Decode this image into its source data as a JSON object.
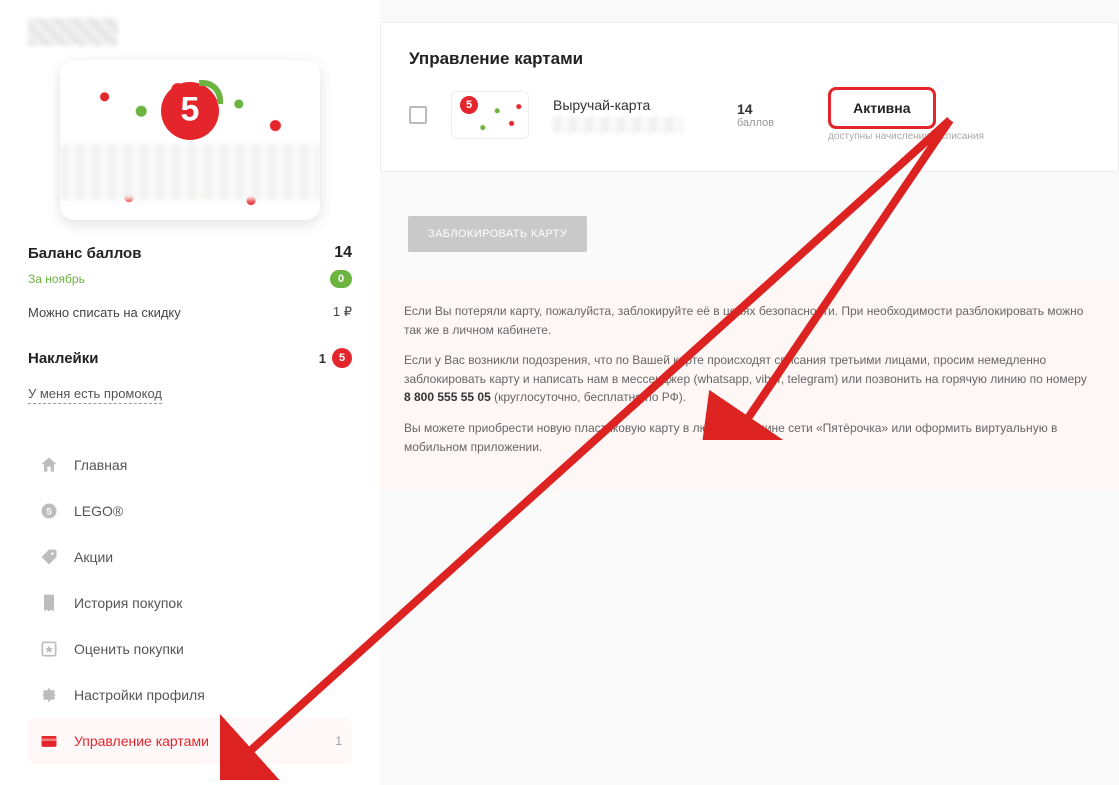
{
  "sidebar": {
    "balance_label": "Баланс баллов",
    "balance_value": "14",
    "balance_month_label": "За ноябрь",
    "balance_month_value": "0",
    "discount_label": "Можно списать на скидку",
    "discount_value": "1 ₽",
    "stickers_label": "Наклейки",
    "stickers_value": "1",
    "promo_link": "У меня есть промокод",
    "nav": [
      {
        "label": "Главная",
        "icon": "home"
      },
      {
        "label": "LEGO®",
        "icon": "lego"
      },
      {
        "label": "Акции",
        "icon": "tag"
      },
      {
        "label": "История покупок",
        "icon": "receipt"
      },
      {
        "label": "Оценить покупки",
        "icon": "star"
      },
      {
        "label": "Настройки профиля",
        "icon": "gear"
      },
      {
        "label": "Управление картами",
        "icon": "card",
        "active": true,
        "count": "1"
      }
    ]
  },
  "main": {
    "title": "Управление картами",
    "card": {
      "name": "Выручай-карта",
      "points": "14",
      "points_label": "баллов",
      "status": "Активна",
      "status_sub": "доступны начисления и списания"
    },
    "block_button": "ЗАБЛОКИРОВАТЬ КАРТУ",
    "info_p1": "Если Вы потеряли карту, пожалуйста, заблокируйте её в целях безопасности. При необходимости разблокировать можно так же в личном кабинете.",
    "info_p2_a": "Если у Вас возникли подозрения, что по Вашей карте происходят списания третьими лицами, просим немедленно заблокировать карту и написать нам в мессенджер (whatsapp, viber, telegram) или позвонить на горячую линию по номеру ",
    "info_p2_bold": "8 800 555 55 05",
    "info_p2_b": " (круглосуточно, бесплатно по РФ).",
    "info_p3": "Вы можете приобрести новую пластиковую карту в любом магазине сети «Пятёрочка» или оформить виртуальную в мобильном приложении."
  }
}
